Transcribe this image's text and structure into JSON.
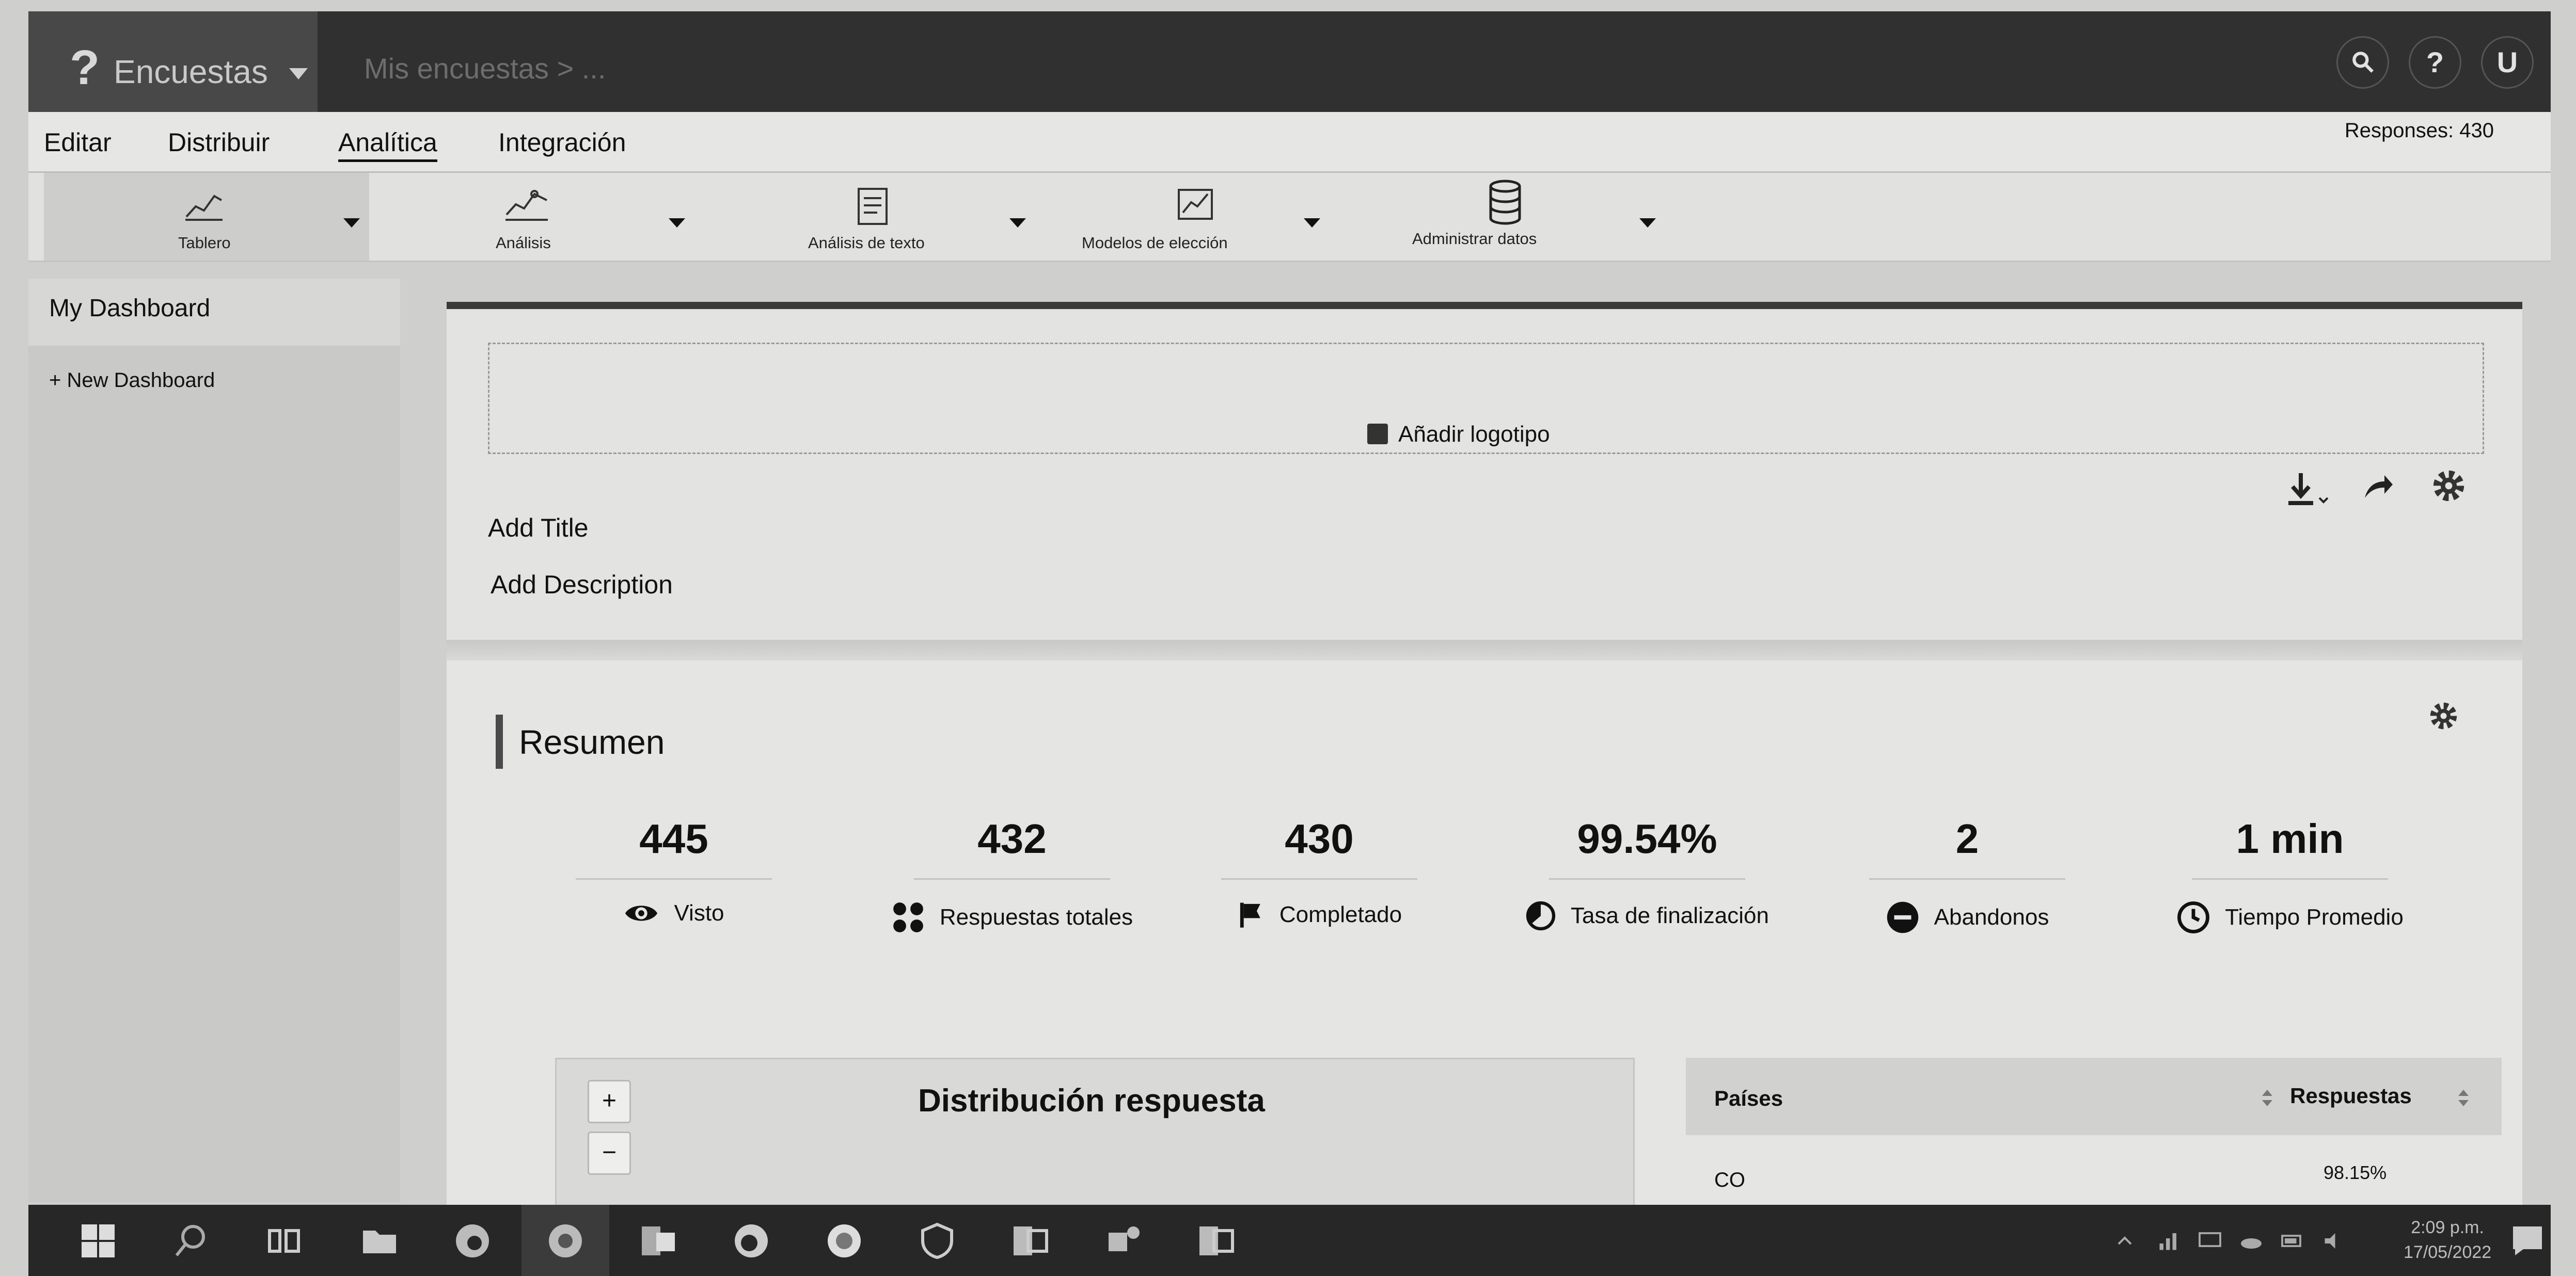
{
  "app": {
    "brand_glyph": "?",
    "product": "Encuestas",
    "survey_name": "Mis encuestas > ..."
  },
  "top_icons": {
    "search": "search-icon",
    "help": "?",
    "user": "U"
  },
  "menu": {
    "items": [
      "Editar",
      "Distribuir",
      "Analítica",
      "Integración"
    ],
    "active": "Analítica",
    "responses": "Responses: 430"
  },
  "toolbar": {
    "items": [
      "Tablero",
      "Análisis",
      "Análisis de texto",
      "Modelos de elección",
      "Administrar datos"
    ]
  },
  "sidebar": {
    "title": "My Dashboard",
    "new_label": "+ New Dashboard"
  },
  "header": {
    "logo_label": "Añadir logotipo",
    "add_title": "Add Title",
    "add_description": "Add Description"
  },
  "summary": {
    "title": "Resumen",
    "stats": [
      {
        "value": "445",
        "label": "Visto",
        "icon": "eye-icon"
      },
      {
        "value": "432",
        "label": "Respuestas totales",
        "icon": "grid-icon"
      },
      {
        "value": "430",
        "label": "Completado",
        "icon": "flag-icon"
      },
      {
        "value": "99.54%",
        "label": "Tasa de finalización",
        "icon": "pie-icon"
      },
      {
        "value": "2",
        "label": "Abandonos",
        "icon": "minus-circle-icon"
      },
      {
        "value": "1 min",
        "label": "Tiempo Promedio",
        "icon": "clock-icon"
      }
    ]
  },
  "distribution": {
    "title": "Distribución respuesta",
    "zoom_in": "+",
    "zoom_out": "−"
  },
  "country_table": {
    "col_country": "Países",
    "col_responses": "Respuestas",
    "rows": [
      {
        "country": "CO",
        "pct": "98.15%"
      }
    ]
  },
  "taskbar": {
    "time": "2:09 p.m.",
    "date": "17/05/2022"
  },
  "colors": {
    "topbar": "#2f302f",
    "page": "#e3e3e1",
    "accent": "#111111"
  }
}
